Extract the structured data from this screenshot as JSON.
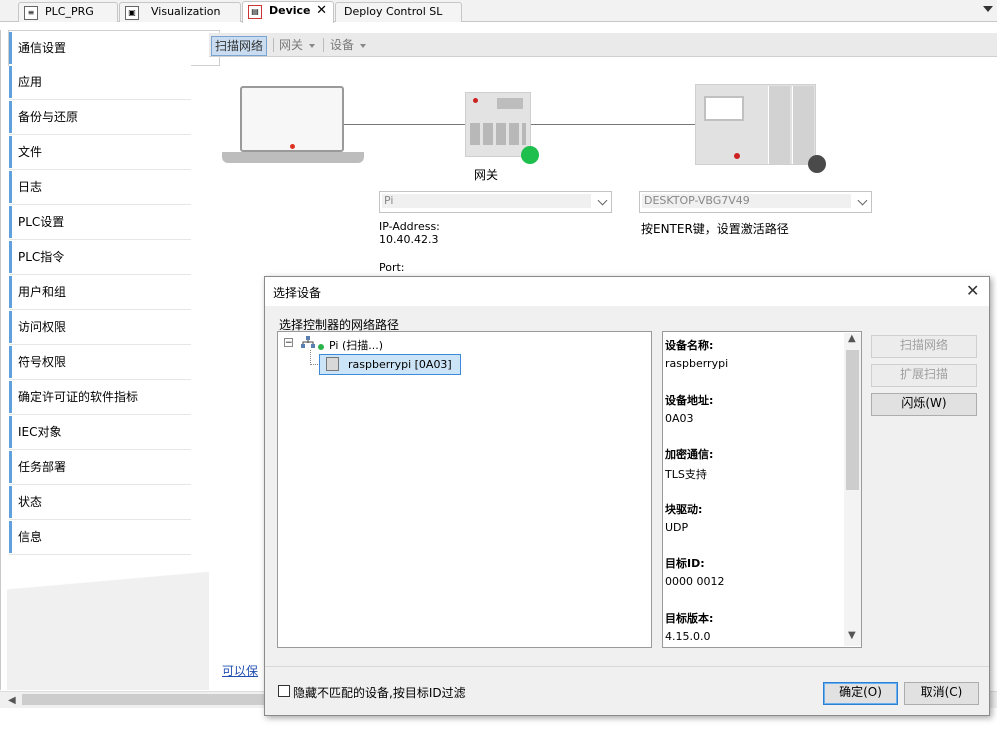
{
  "tabs": [
    {
      "label": "PLC_PRG",
      "active": false
    },
    {
      "label": "Visualization",
      "active": false
    },
    {
      "label": "Device",
      "active": true
    },
    {
      "label": "Deploy Control SL",
      "active": false
    }
  ],
  "nav": {
    "items": [
      "通信设置",
      "应用",
      "备份与还原",
      "文件",
      "日志",
      "PLC设置",
      "PLC指令",
      "用户和组",
      "访问权限",
      "符号权限",
      "确定许可证的软件指标",
      "IEC对象",
      "任务部署",
      "状态",
      "信息"
    ],
    "selected_index": 0
  },
  "toolbar": {
    "scan_label": "扫描网络",
    "gateway_label": "网关",
    "device_label": "设备"
  },
  "diagram": {
    "gateway_label": "网关",
    "gateway_combo": "Pi",
    "ip_label": "IP-Address:",
    "ip_value": "10.40.42.3",
    "port_label": "Port:",
    "device_combo": "DESKTOP-VBG7V49",
    "hint": "按ENTER键，设置激活路径",
    "gateway_status_color": "#1fbf4e",
    "device_status_color": "#4a4a4a"
  },
  "save_link": "可以保",
  "dialog": {
    "title": "选择设备",
    "close_glyph": "✕",
    "tree_label": "选择控制器的网络路径",
    "tree": {
      "root": "Pi (扫描...)",
      "child": "raspberrypi [0A03]",
      "expander": "−"
    },
    "info": [
      {
        "k": "设备名称:",
        "v": "raspberrypi"
      },
      {
        "k": "设备地址:",
        "v": "0A03"
      },
      {
        "k": "加密通信:",
        "v": "TLS支持"
      },
      {
        "k": "块驱动:",
        "v": "UDP"
      },
      {
        "k": "目标ID:",
        "v": "0000 0012"
      },
      {
        "k": "目标版本:",
        "v": "4.15.0.0"
      }
    ],
    "buttons": {
      "scan": "扫描网络",
      "extend_scan": "扩展扫描",
      "wink": "闪烁(W)",
      "ok": "确定(O)",
      "cancel": "取消(C)"
    },
    "checkbox_label": "隐藏不匹配的设备,按目标ID过滤"
  }
}
